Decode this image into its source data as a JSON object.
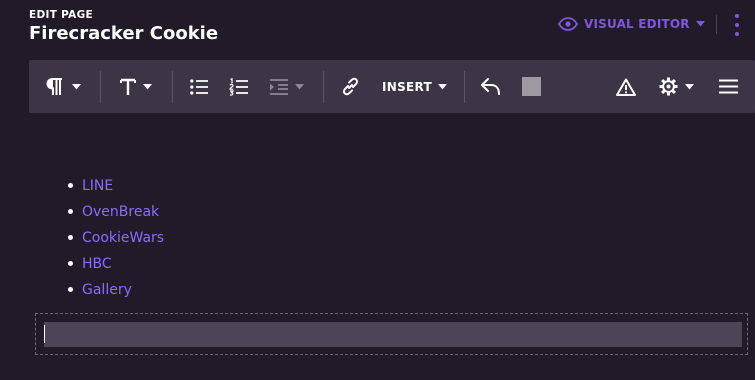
{
  "header": {
    "edit_label": "EDIT PAGE",
    "title": "Firecracker Cookie",
    "editor_mode": "VISUAL EDITOR",
    "editor_icon": "eye-icon",
    "menu_icon": "kebab-icon"
  },
  "toolbar": {
    "items": [
      {
        "name": "paragraph-format",
        "icon": "pilcrow-icon",
        "dropdown": true
      },
      {
        "name": "text-style",
        "icon": "text-style-icon",
        "dropdown": true
      },
      {
        "name": "bullet-list",
        "icon": "bullet-list-icon"
      },
      {
        "name": "numbered-list",
        "icon": "numbered-list-icon"
      },
      {
        "name": "indentation",
        "icon": "indent-icon",
        "dropdown": true,
        "disabled": true
      },
      {
        "name": "link",
        "icon": "link-icon"
      },
      {
        "name": "insert",
        "icon": "",
        "dropdown": true
      },
      {
        "name": "undo",
        "icon": "undo-icon"
      },
      {
        "name": "color-swatch",
        "icon": "swatch-icon"
      },
      {
        "name": "warnings",
        "icon": "warning-icon"
      },
      {
        "name": "settings",
        "icon": "gear-icon",
        "dropdown": true
      },
      {
        "name": "page-menu",
        "icon": "hamburger-icon"
      }
    ],
    "insert_label": "INSERT"
  },
  "content": {
    "list": [
      "LINE",
      "OvenBreak",
      "CookieWars",
      "HBC",
      "Gallery"
    ]
  },
  "colors": {
    "background": "#201a29",
    "toolbar": "#3b3546",
    "accent": "#7f5ad6",
    "link": "#8b6cff",
    "paragraph_fill": "#4b4556"
  }
}
